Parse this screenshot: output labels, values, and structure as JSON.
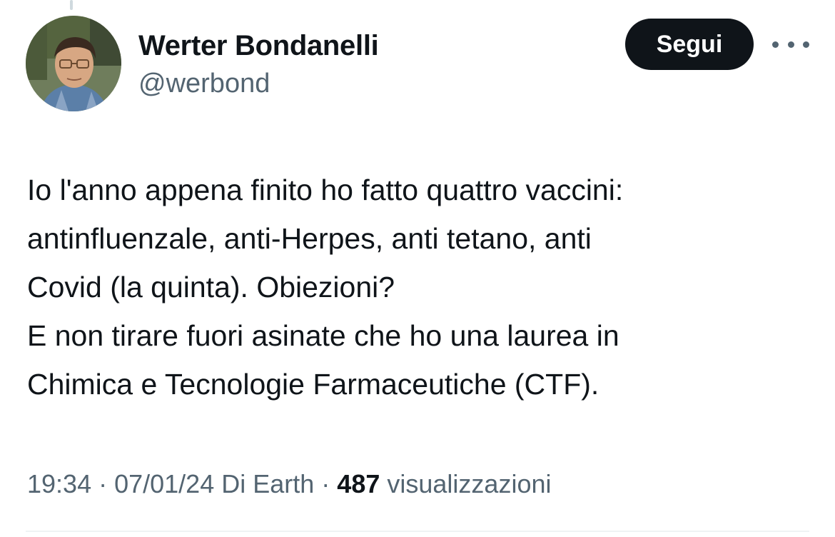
{
  "author": {
    "name": "Werter Bondanelli",
    "handle": "@werbond"
  },
  "actions": {
    "follow_label": "Segui",
    "more_icon": "more-horizontal-icon"
  },
  "tweet": {
    "lines": [
      "Io l'anno appena finito ho fatto quattro vaccini:",
      "antinfluenzale, anti-Herpes, anti tetano, anti",
      "Covid (la quinta). Obiezioni?",
      "E non tirare fuori asinate che ho una laurea in",
      "Chimica e Tecnologie Farmaceutiche (CTF)."
    ]
  },
  "meta": {
    "time": "19:34",
    "separator": " · ",
    "date": "07/01/24",
    "source": "Di Earth",
    "views_count": "487",
    "views_label": "visualizzazioni"
  },
  "colors": {
    "text": "#0f1419",
    "secondary": "#536471",
    "button_bg": "#0f1419",
    "divider": "#eff3f4"
  }
}
